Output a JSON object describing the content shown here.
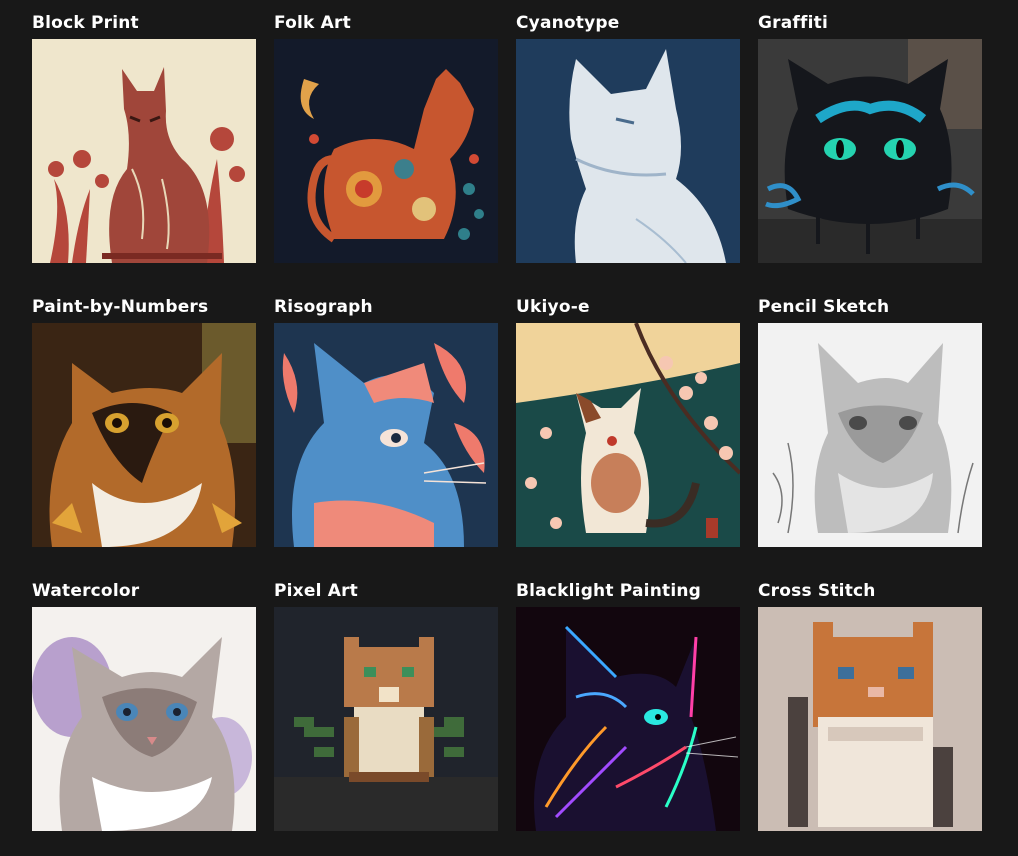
{
  "gallery": {
    "items": [
      {
        "label": "Block Print",
        "image": "cat-block-print-image",
        "bg": "#efe6cc"
      },
      {
        "label": "Folk Art",
        "image": "cat-folk-art-image",
        "bg": "#131a2a"
      },
      {
        "label": "Cyanotype",
        "image": "cat-cyanotype-image",
        "bg": "#1f3c5c"
      },
      {
        "label": "Graffiti",
        "image": "cat-graffiti-image",
        "bg": "#3a3a3a"
      },
      {
        "label": "Paint-by-Numbers",
        "image": "cat-paint-by-numbers-image",
        "bg": "#3a2514"
      },
      {
        "label": "Risograph",
        "image": "cat-risograph-image",
        "bg": "#1e3550"
      },
      {
        "label": "Ukiyo-e",
        "image": "cat-ukiyo-e-image",
        "bg": "#1a4a48"
      },
      {
        "label": "Pencil Sketch",
        "image": "cat-pencil-sketch-image",
        "bg": "#f2f2f2"
      },
      {
        "label": "Watercolor",
        "image": "cat-watercolor-image",
        "bg": "#f4f1ee"
      },
      {
        "label": "Pixel Art",
        "image": "cat-pixel-art-image",
        "bg": "#20242c"
      },
      {
        "label": "Blacklight Painting",
        "image": "cat-blacklight-painting-image",
        "bg": "#12060e"
      },
      {
        "label": "Cross Stitch",
        "image": "cat-cross-stitch-image",
        "bg": "#cbbdb4"
      }
    ]
  }
}
